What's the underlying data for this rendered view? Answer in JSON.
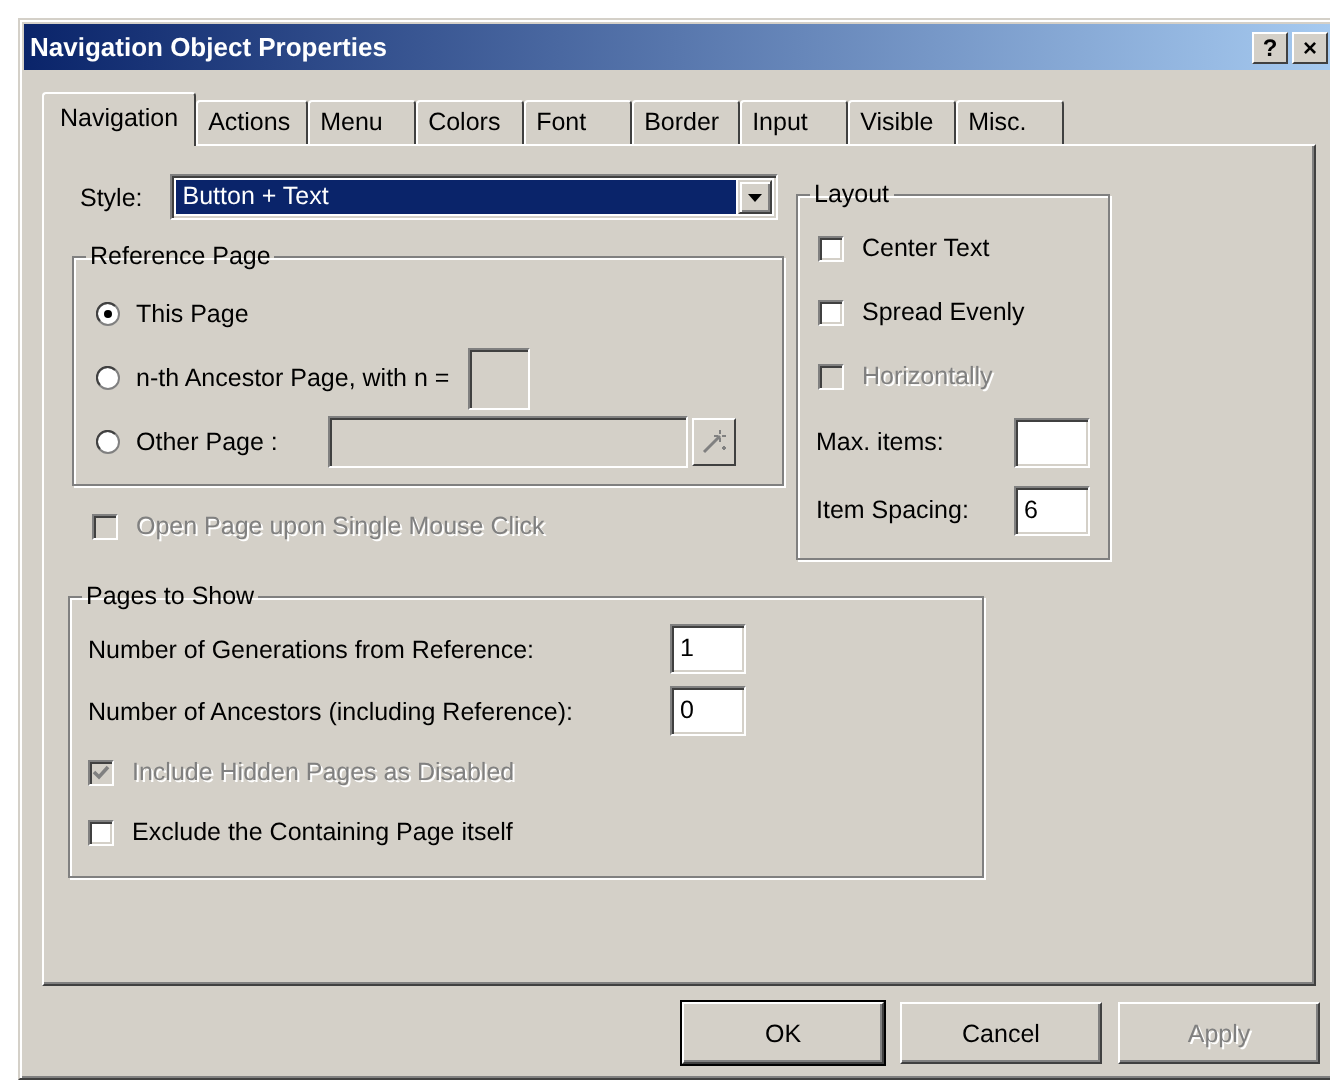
{
  "window": {
    "title": "Navigation Object Properties",
    "help_button": "?",
    "close_button": "×"
  },
  "tabs": [
    {
      "label": "Navigation",
      "selected": true
    },
    {
      "label": "Actions",
      "selected": false
    },
    {
      "label": "Menu",
      "selected": false
    },
    {
      "label": "Colors",
      "selected": false
    },
    {
      "label": "Font",
      "selected": false
    },
    {
      "label": "Border",
      "selected": false
    },
    {
      "label": "Input",
      "selected": false
    },
    {
      "label": "Visible",
      "selected": false
    },
    {
      "label": "Misc.",
      "selected": false
    }
  ],
  "style": {
    "label": "Style:",
    "value": "Button + Text"
  },
  "reference_page": {
    "title": "Reference Page",
    "options": [
      {
        "label": "This Page",
        "selected": true,
        "kind": "plain"
      },
      {
        "label": "n-th Ancestor Page, with n =",
        "selected": false,
        "kind": "number"
      },
      {
        "label": "Other Page :",
        "selected": false,
        "kind": "page"
      }
    ]
  },
  "open_page_single_click": {
    "label": "Open Page upon Single Mouse Click",
    "checked": false,
    "disabled": true
  },
  "layout": {
    "title": "Layout",
    "checkboxes": [
      {
        "label": "Center Text",
        "checked": false,
        "disabled": false
      },
      {
        "label": "Spread Evenly",
        "checked": false,
        "disabled": false
      },
      {
        "label": "Horizontally",
        "checked": false,
        "disabled": true
      }
    ],
    "fields": [
      {
        "label": "Max. items:"
      },
      {
        "label": "Item Spacing:",
        "value": "6"
      }
    ]
  },
  "pages_to_show": {
    "title": "Pages to Show",
    "fields": [
      {
        "label": "Number of Generations from Reference:",
        "value": "1"
      },
      {
        "label": "Number of Ancestors (including Reference):",
        "value": "0"
      }
    ],
    "checkboxes": [
      {
        "label": "Include Hidden Pages as Disabled",
        "checked": true,
        "disabled": true
      },
      {
        "label": "Exclude the Containing Page itself",
        "checked": false,
        "disabled": false
      }
    ]
  },
  "buttons": [
    {
      "label": "OK",
      "default": true,
      "disabled": false
    },
    {
      "label": "Cancel",
      "default": false,
      "disabled": false
    },
    {
      "label": "Apply",
      "default": false,
      "disabled": true
    }
  ]
}
